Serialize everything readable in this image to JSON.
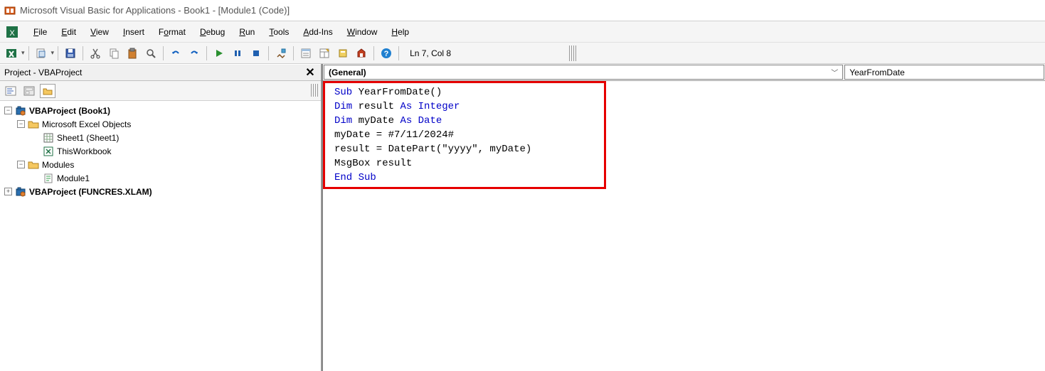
{
  "titlebar": {
    "text": "Microsoft Visual Basic for Applications - Book1 - [Module1 (Code)]"
  },
  "menu": {
    "items": [
      "File",
      "Edit",
      "View",
      "Insert",
      "Format",
      "Debug",
      "Run",
      "Tools",
      "Add-Ins",
      "Window",
      "Help"
    ]
  },
  "toolbar": {
    "cursor_pos": "Ln 7, Col 8"
  },
  "project_panel": {
    "title": "Project - VBAProject",
    "tree": {
      "root1": "VBAProject (Book1)",
      "excel_objects": "Microsoft Excel Objects",
      "sheet1": "Sheet1 (Sheet1)",
      "thiswb": "ThisWorkbook",
      "modules": "Modules",
      "module1": "Module1",
      "root2": "VBAProject (FUNCRES.XLAM)"
    }
  },
  "code_dropdowns": {
    "left": "(General)",
    "right": "YearFromDate"
  },
  "code": {
    "l1_kw": "Sub",
    "l1_rest": " YearFromDate()",
    "l2_kw1": "Dim",
    "l2_mid": " result ",
    "l2_kw2": "As Integer",
    "l3_kw1": "Dim",
    "l3_mid": " myDate ",
    "l3_kw2": "As Date",
    "l4": "myDate = #7/11/2024#",
    "l5": "result = DatePart(\"yyyy\", myDate)",
    "l6": "MsgBox result",
    "l7_kw": "End Sub"
  }
}
